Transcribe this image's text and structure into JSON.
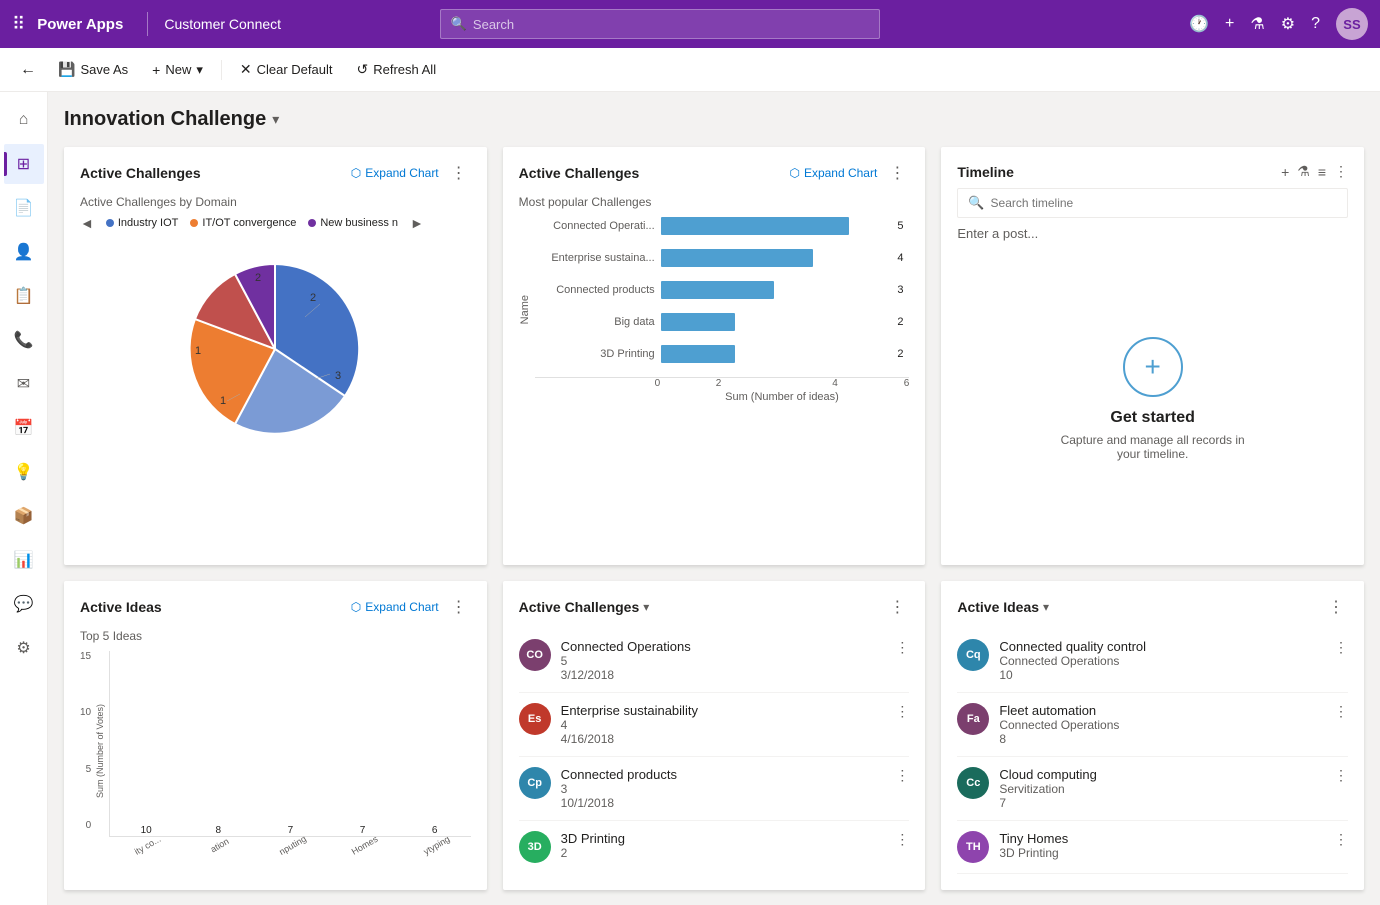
{
  "topNav": {
    "appName": "Power Apps",
    "appTitle": "Customer Connect",
    "searchPlaceholder": "Search",
    "avatarInitials": "SS"
  },
  "toolbar": {
    "backLabel": "‹",
    "saveAsLabel": "Save As",
    "newLabel": "New",
    "clearDefaultLabel": "Clear Default",
    "refreshAllLabel": "Refresh All"
  },
  "pageTitle": "Innovation Challenge",
  "activeChallengePie": {
    "title": "Active Challenges",
    "expandLabel": "Expand Chart",
    "subtitle": "Active Challenges by Domain",
    "legend": [
      {
        "label": "Industry IOT",
        "color": "#4472c4"
      },
      {
        "label": "IT/OT convergence",
        "color": "#ed7d31"
      },
      {
        "label": "New business n",
        "color": "#7030a0"
      }
    ],
    "slices": [
      {
        "label": "2",
        "color": "#4472c4",
        "percent": 28
      },
      {
        "label": "3",
        "color": "#4472c4",
        "percent": 32
      },
      {
        "label": "1",
        "color": "#ed7d31",
        "percent": 18
      },
      {
        "label": "2",
        "color": "#c0504d",
        "percent": 12
      },
      {
        "label": "1",
        "color": "#7030a0",
        "percent": 10
      }
    ]
  },
  "activeChallengeBars": {
    "title": "Active Challenges",
    "expandLabel": "Expand Chart",
    "subtitle": "Most popular Challenges",
    "yAxisLabel": "Name",
    "xAxisLabel": "Sum (Number of ideas)",
    "bars": [
      {
        "label": "Connected Operati...",
        "value": 5,
        "maxValue": 6
      },
      {
        "label": "Enterprise sustaina...",
        "value": 4,
        "maxValue": 6
      },
      {
        "label": "Connected products",
        "value": 3,
        "maxValue": 6
      },
      {
        "label": "Big data",
        "value": 2,
        "maxValue": 6
      },
      {
        "label": "3D Printing",
        "value": 2,
        "maxValue": 6
      }
    ],
    "axisMarks": [
      "0",
      "2",
      "4",
      "6"
    ]
  },
  "timeline": {
    "title": "Timeline",
    "searchPlaceholder": "Search timeline",
    "postPlaceholder": "Enter a post...",
    "emptyTitle": "Get started",
    "emptyDesc": "Capture and manage all records in your timeline."
  },
  "activeIdeasChart": {
    "title": "Active Ideas",
    "expandLabel": "Expand Chart",
    "subtitle": "Top 5 Ideas",
    "yAxisLabel": "Sum (Number of Votes)",
    "bars": [
      {
        "label": "ity co...",
        "value": 10
      },
      {
        "label": "ation",
        "value": 8
      },
      {
        "label": "nputing",
        "value": 7
      },
      {
        "label": "Homes",
        "value": 7
      },
      {
        "label": "ytyping",
        "value": 6
      }
    ],
    "yAxisMarks": [
      "15",
      "10",
      "5",
      "0"
    ]
  },
  "activeChallengesList": {
    "title": "Active Challenges",
    "items": [
      {
        "initials": "CO",
        "color": "#7b3f6e",
        "title": "Connected Operations",
        "count": "5",
        "date": "3/12/2018"
      },
      {
        "initials": "Es",
        "color": "#c0392b",
        "title": "Enterprise sustainability",
        "count": "4",
        "date": "4/16/2018"
      },
      {
        "initials": "Cp",
        "color": "#2e86ab",
        "title": "Connected products",
        "count": "3",
        "date": "10/1/2018"
      },
      {
        "initials": "3D",
        "color": "#27ae60",
        "title": "3D Printing",
        "count": "2",
        "date": ""
      }
    ]
  },
  "activeIdeasList": {
    "title": "Active Ideas",
    "items": [
      {
        "initials": "Cq",
        "color": "#2e86ab",
        "title": "Connected quality control",
        "subtitle": "Connected Operations",
        "count": "10"
      },
      {
        "initials": "Fa",
        "color": "#7b3f6e",
        "title": "Fleet automation",
        "subtitle": "Connected Operations",
        "count": "8"
      },
      {
        "initials": "Cc",
        "color": "#1a6b5c",
        "title": "Cloud computing",
        "subtitle": "Servitization",
        "count": "7"
      },
      {
        "initials": "TH",
        "color": "#8e44ad",
        "title": "Tiny Homes",
        "subtitle": "3D Printing",
        "count": ""
      }
    ]
  },
  "sidebarIcons": [
    {
      "name": "home-icon",
      "symbol": "⌂",
      "active": false
    },
    {
      "name": "dashboard-icon",
      "symbol": "⊞",
      "active": true
    },
    {
      "name": "document-icon",
      "symbol": "📄",
      "active": false
    },
    {
      "name": "person-icon",
      "symbol": "👤",
      "active": false
    },
    {
      "name": "contacts-icon",
      "symbol": "📋",
      "active": false
    },
    {
      "name": "phone-icon",
      "symbol": "📞",
      "active": false
    },
    {
      "name": "mail-icon",
      "symbol": "✉",
      "active": false
    },
    {
      "name": "calendar-icon",
      "symbol": "📅",
      "active": false
    },
    {
      "name": "bulb-icon",
      "symbol": "💡",
      "active": false
    },
    {
      "name": "box-icon",
      "symbol": "📦",
      "active": false
    },
    {
      "name": "chart-icon",
      "symbol": "📊",
      "active": false
    },
    {
      "name": "chat-icon",
      "symbol": "💬",
      "active": false
    },
    {
      "name": "settings-icon",
      "symbol": "⚙",
      "active": false
    }
  ]
}
